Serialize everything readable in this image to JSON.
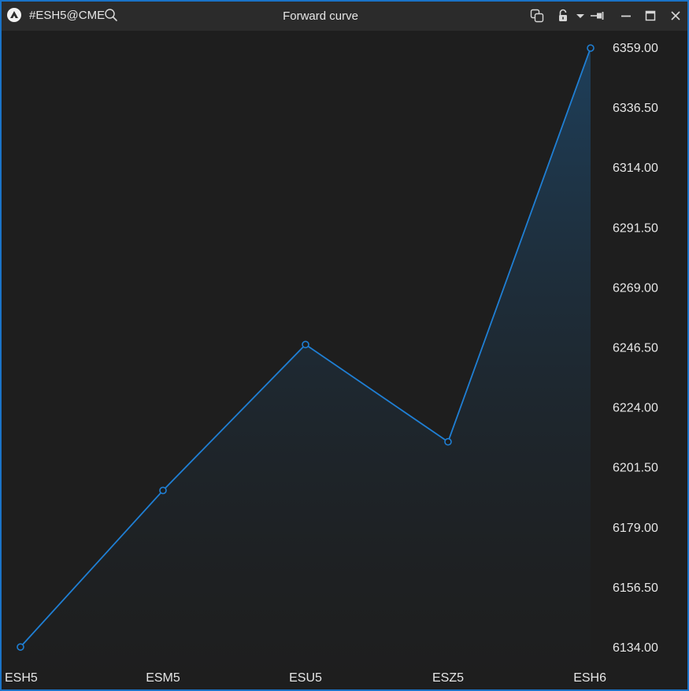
{
  "window": {
    "symbol": "#ESH5@CME",
    "title": "Forward curve"
  },
  "icons": {
    "logo": "app-logo-icon",
    "search": "search-icon",
    "link": "link-windows-icon",
    "lock": "lock-open-icon",
    "dropdown": "caret-down-icon",
    "pin": "pin-icon",
    "minimize": "minimize-icon",
    "maximize": "maximize-icon",
    "close": "close-icon"
  },
  "colors": {
    "accent": "#1a73c7",
    "line": "#1f7fd4",
    "background": "#1e1e1e",
    "titlebar": "#2b2b2b",
    "text": "#e6e6e6"
  },
  "chart_data": {
    "type": "area",
    "categories": [
      "ESH5",
      "ESM5",
      "ESU5",
      "ESZ5",
      "ESH6"
    ],
    "series": [
      {
        "values": [
          6134.25,
          6193.0,
          6247.75,
          6211.25,
          6359.0
        ]
      }
    ],
    "yticks": [
      "6134.00",
      "6156.50",
      "6179.00",
      "6201.50",
      "6224.00",
      "6246.50",
      "6269.00",
      "6291.50",
      "6314.00",
      "6336.50",
      "6359.00"
    ],
    "ylim": [
      6134.0,
      6359.0
    ],
    "xlabel": "",
    "ylabel": "",
    "grid": false,
    "markers": "hollow-circle"
  }
}
